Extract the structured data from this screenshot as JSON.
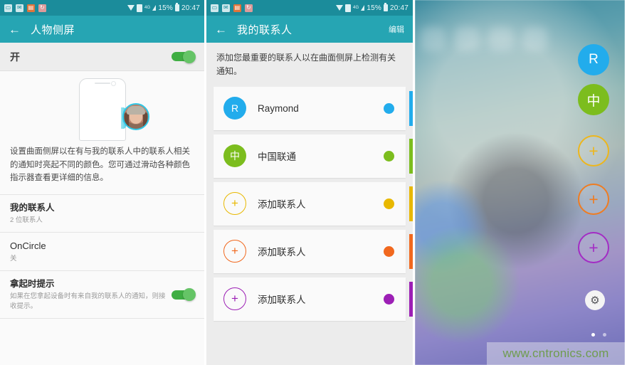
{
  "statusbar": {
    "icons": [
      "sd-card-icon",
      "email-icon",
      "note-icon",
      "sync-icon"
    ],
    "wifi_icon": "wifi-icon",
    "sim_icon": "sim-card-icon",
    "network_label": "4G",
    "signal_icon": "signal-bars-icon",
    "battery_percent": "15%",
    "battery_icon": "battery-icon",
    "clock": "20:47"
  },
  "panel1": {
    "appbar": {
      "back": "←",
      "title": "人物侧屏"
    },
    "master": {
      "label": "开",
      "enabled": true
    },
    "illustration": {
      "name": "curved-edge-phone-illustration",
      "avatar": "contact-photo-avatar"
    },
    "description": "设置曲面侧屏以在有与我的联系人中的联系人相关的通知时亮起不同的颜色。您可通过滑动各种颜色指示器查看更详细的信息。",
    "items": [
      {
        "title": "我的联系人",
        "sub": "2 位联系人",
        "has_switch": false,
        "bold": true
      },
      {
        "title": "OnCircle",
        "sub": "关",
        "has_switch": false,
        "bold": false
      },
      {
        "title": "拿起时提示",
        "sub": "如果在您拿起设备时有来自我的联系人的通知，则接收提示。",
        "has_switch": true,
        "bold": true
      }
    ]
  },
  "panel2": {
    "appbar": {
      "back": "←",
      "title": "我的联系人",
      "action": "编辑"
    },
    "intro": "添加您最重要的联系人以在曲面侧屏上检测有关通知。",
    "add_label": "添加联系人",
    "contacts": [
      {
        "initial": "R",
        "name": "Raymond",
        "color": "#22acec",
        "filled": true
      },
      {
        "initial": "中",
        "name": "中国联通",
        "color": "#7cbd1e",
        "filled": true
      },
      {
        "initial": "+",
        "name": "添加联系人",
        "color": "#e8b800",
        "filled": false
      },
      {
        "initial": "+",
        "name": "添加联系人",
        "color": "#f1681e",
        "filled": false
      },
      {
        "initial": "+",
        "name": "添加联系人",
        "color": "#9c1fb5",
        "filled": false
      }
    ]
  },
  "panel3": {
    "name": "people-edge-panel-preview",
    "buttons": [
      {
        "initial": "R",
        "color": "#22acec",
        "filled": true,
        "name": "edge-contact-raymond"
      },
      {
        "initial": "中",
        "color": "#7cbd1e",
        "filled": true,
        "name": "edge-contact-china-unicom"
      },
      {
        "initial": "+",
        "color": "#edb61c",
        "filled": false,
        "name": "edge-add-contact-yellow"
      },
      {
        "initial": "+",
        "color": "#ef7c21",
        "filled": false,
        "name": "edge-add-contact-orange"
      },
      {
        "initial": "+",
        "color": "#a32cc4",
        "filled": false,
        "name": "edge-add-contact-purple"
      }
    ],
    "gear": "⚙",
    "dots": {
      "count": 2,
      "active": 0
    },
    "watermark": "www.cntronics.com"
  }
}
